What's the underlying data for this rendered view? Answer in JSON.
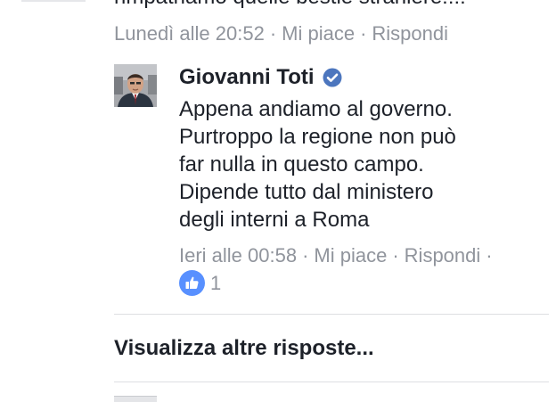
{
  "previous_comment": {
    "text_cut": "rimpatriamo quelle bestie straniere!!!!",
    "timestamp": "Lunedì alle 20:52",
    "like_label": "Mi piace",
    "reply_label": "Rispondi",
    "separator": "·"
  },
  "reply": {
    "author": "Giovanni Toti",
    "verified_icon": "verified-badge-icon",
    "text_lines": [
      "Appena andiamo al governo.",
      "Purtroppo la regione non può",
      "far nulla in questo campo.",
      "Dipende tutto dal ministero",
      "degli interni a Roma"
    ],
    "timestamp": "Ieri alle 00:58",
    "like_label": "Mi piace",
    "reply_label": "Rispondi",
    "separator": "·",
    "reaction_icon": "thumbs-up-icon",
    "reaction_count": "1"
  },
  "more_replies_label": "Visualizza altre risposte...",
  "colors": {
    "text": "#1d2129",
    "meta": "#90949c",
    "verified": "#4c76be",
    "like": "#5890ff",
    "divider": "#dddfe2"
  }
}
